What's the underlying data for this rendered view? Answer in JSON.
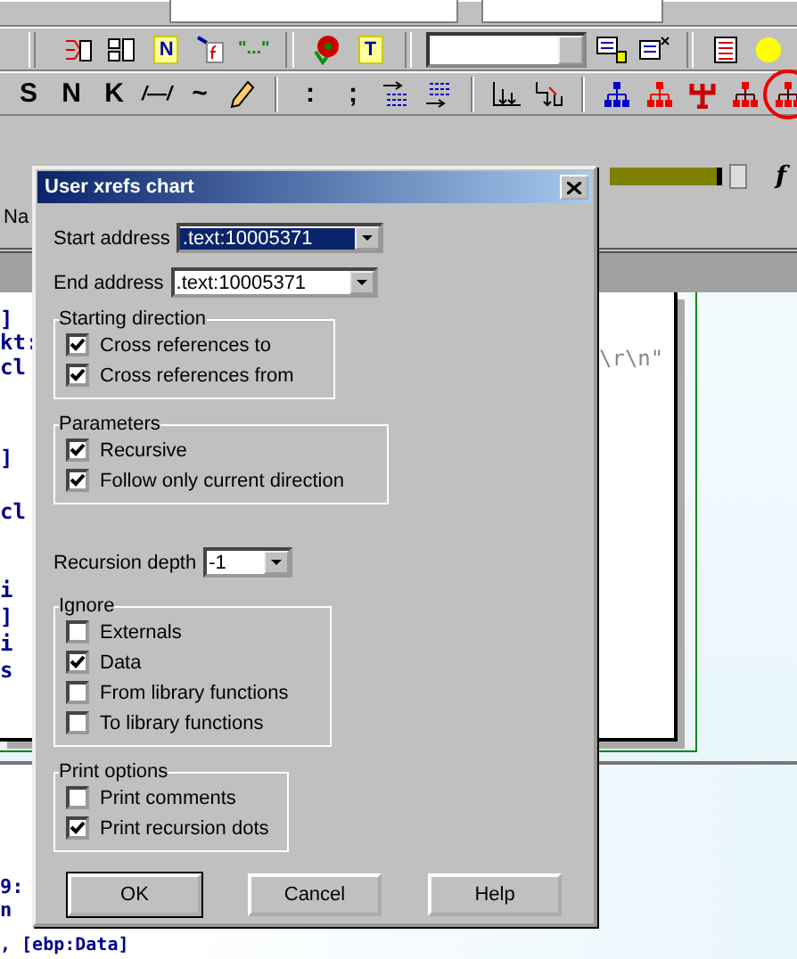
{
  "toolbar_row_2": [
    {
      "kind": "icon"
    },
    {
      "kind": "icon"
    },
    {
      "kind": "boxed_text",
      "label": "N"
    },
    {
      "kind": "icon"
    },
    {
      "kind": "text",
      "label": "\"...\""
    },
    {
      "kind": "separator"
    },
    {
      "kind": "icon"
    },
    {
      "kind": "boxed_text",
      "label": "T"
    },
    {
      "kind": "separator"
    },
    {
      "kind": "dropdown"
    },
    {
      "kind": "icon"
    },
    {
      "kind": "icon"
    },
    {
      "kind": "separator"
    },
    {
      "kind": "icon"
    },
    {
      "kind": "icon"
    }
  ],
  "toolbar_row_3": [
    {
      "kind": "text",
      "label": "S",
      "circled": false
    },
    {
      "kind": "text",
      "label": "N",
      "circled": false
    },
    {
      "kind": "text",
      "label": "K",
      "circled": false
    },
    {
      "kind": "text",
      "label": "/—/",
      "circled": false
    },
    {
      "kind": "text",
      "label": "~",
      "circled": false
    },
    {
      "kind": "icon",
      "circled": false
    },
    {
      "kind": "separator"
    },
    {
      "kind": "text",
      "label": ":",
      "circled": false
    },
    {
      "kind": "text",
      "label": ";",
      "circled": false
    },
    {
      "kind": "icon",
      "circled": false
    },
    {
      "kind": "icon",
      "circled": false
    },
    {
      "kind": "separator"
    },
    {
      "kind": "icon",
      "circled": false
    },
    {
      "kind": "icon",
      "circled": false
    },
    {
      "kind": "separator"
    },
    {
      "kind": "icon",
      "circled": false
    },
    {
      "kind": "icon",
      "circled": false
    },
    {
      "kind": "icon",
      "circled": false
    },
    {
      "kind": "icon",
      "circled": false
    },
    {
      "kind": "icon",
      "circled": true
    }
  ],
  "function_button": "f",
  "tab_label": "Na",
  "code_lines": [
    {
      "text": "]"
    },
    {
      "text": "kt:"
    },
    {
      "text": "cl"
    },
    {
      "text": "]"
    },
    {
      "text": "cl"
    },
    {
      "text": "i"
    },
    {
      "text": "]"
    },
    {
      "text": "i"
    },
    {
      "text": "s"
    }
  ],
  "string_fragment": "\\r\\n\"",
  "lower_lines": [
    {
      "text": "9:"
    },
    {
      "text": "n"
    },
    {
      "text": ", [ebp:Data]"
    }
  ],
  "dialog": {
    "title": "User xrefs chart",
    "sections": [
      {
        "kind": "combo",
        "label": "Start address",
        "value": ".text:10005371",
        "highlighted": true
      },
      {
        "kind": "combo",
        "label": "End address",
        "value": ".text:10005371",
        "highlighted": false
      },
      {
        "kind": "group",
        "title": "Starting direction",
        "options": [
          {
            "label": "Cross references to",
            "checked": true
          },
          {
            "label": "Cross references from",
            "checked": true
          }
        ]
      },
      {
        "kind": "group",
        "title": "Parameters",
        "options": [
          {
            "label": "Recursive",
            "checked": true
          },
          {
            "label": "Follow only current direction",
            "checked": true
          }
        ]
      },
      {
        "kind": "combo",
        "label": "Recursion depth",
        "value": "-1",
        "highlighted": false
      },
      {
        "kind": "group",
        "title": "Ignore",
        "options": [
          {
            "label": "Externals",
            "checked": false
          },
          {
            "label": "Data",
            "checked": true
          },
          {
            "label": "From library functions",
            "checked": false
          },
          {
            "label": "To library functions",
            "checked": false
          }
        ]
      },
      {
        "kind": "group",
        "title": "Print options",
        "options": [
          {
            "label": "Print comments",
            "checked": false
          },
          {
            "label": "Print recursion dots",
            "checked": true
          }
        ]
      }
    ],
    "buttons": [
      {
        "label": "OK",
        "default": true
      },
      {
        "label": "Cancel",
        "default": false
      },
      {
        "label": "Help",
        "default": false
      }
    ]
  }
}
